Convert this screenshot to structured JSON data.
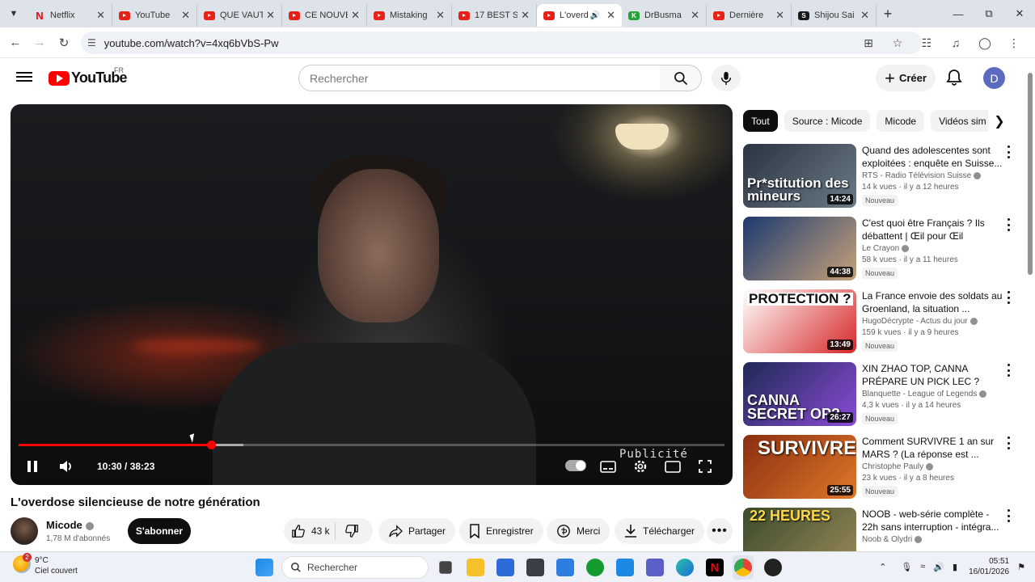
{
  "browser": {
    "tabs": [
      {
        "title": "Netflix",
        "icon": "netflix-icon"
      },
      {
        "title": "YouTube",
        "icon": "youtube-icon"
      },
      {
        "title": "QUE VAUT",
        "icon": "youtube-icon"
      },
      {
        "title": "CE NOUVE",
        "icon": "youtube-icon"
      },
      {
        "title": "Mistaking",
        "icon": "youtube-icon"
      },
      {
        "title": "17 BEST S",
        "icon": "youtube-icon"
      },
      {
        "title": "L'overd",
        "icon": "youtube-icon",
        "active": true,
        "audio": true
      },
      {
        "title": "DrBusma",
        "icon": "green-k-icon"
      },
      {
        "title": "Dernière",
        "icon": "youtube-icon"
      },
      {
        "title": "Shijou Sai",
        "icon": "shijou-icon"
      }
    ],
    "url": "youtube.com/watch?v=4xq6bVbS-Pw"
  },
  "youtube": {
    "logo_text": "YouTube",
    "country_code": "FR",
    "search_placeholder": "Rechercher",
    "create_label": "Créer",
    "avatar_letter": "D"
  },
  "player": {
    "time": "10:30 / 38:23",
    "ad_label": "Publicité",
    "progress_fraction": 0.273,
    "buffered_fraction": 0.318
  },
  "video": {
    "title": "L'overdose silencieuse de notre génération",
    "channel": "Micode",
    "subscribers": "1,78 M d'abonnés",
    "subscribe_label": "S'abonner",
    "likes": "43 k",
    "share_label": "Partager",
    "save_label": "Enregistrer",
    "thanks_label": "Merci",
    "download_label": "Télécharger"
  },
  "sidebar": {
    "chips": [
      "Tout",
      "Source : Micode",
      "Micode",
      "Vidéos sim"
    ],
    "recommendations": [
      {
        "title": "Quand des adolescentes sont exploitées : enquête en Suisse...",
        "channel": "RTS - Radio Télévision Suisse",
        "meta": "14 k vues · il y a 12 heures",
        "badge": "Nouveau",
        "duration": "14:24",
        "thumb_text": "Pr*stitution des mineurs",
        "colors": [
          "#2b3440",
          "#6b7a88"
        ]
      },
      {
        "title": "C'est quoi être Français ? Ils débattent | Œil pour Œil",
        "channel": "Le Crayon",
        "meta": "58 k vues · il y a 11 heures",
        "badge": "Nouveau",
        "duration": "44:38",
        "thumb_text": "",
        "colors": [
          "#1c3a6e",
          "#c7a27a"
        ]
      },
      {
        "title": "La France envoie des soldats au Groenland, la situation ...",
        "channel": "HugoDécrypte - Actus du jour",
        "meta": "159 k vues · il y a 9 heures",
        "badge": "Nouveau",
        "duration": "13:49",
        "thumb_text": "PROTECTION ?",
        "colors": [
          "#ffffff",
          "#d62828"
        ]
      },
      {
        "title": "XIN ZHAO TOP, CANNA PRÉPARE UN PICK LEC ?",
        "channel": "Blanquette - League of Legends",
        "meta": "4,3 k vues · il y a 14 heures",
        "badge": "Nouveau",
        "duration": "26:27",
        "thumb_text": "CANNA SECRET OP?",
        "colors": [
          "#1e2a55",
          "#8a4bd6"
        ]
      },
      {
        "title": "Comment SURVIVRE 1 an sur MARS ? (La réponse est ...",
        "channel": "Christophe Pauly",
        "meta": "23 k vues · il y a 8 heures",
        "badge": "Nouveau",
        "duration": "25:55",
        "thumb_text": "SURVIVRE",
        "colors": [
          "#8a2e10",
          "#e0782a"
        ]
      },
      {
        "title": "NOOB - web-série complète - 22h sans interruption - intégra...",
        "channel": "Noob & Olydri",
        "meta": "",
        "badge": "",
        "duration": "",
        "thumb_text": "22 HEURES",
        "colors": [
          "#3a4a2a",
          "#9b8a5a"
        ]
      }
    ]
  },
  "taskbar": {
    "temperature": "9°C",
    "weather": "Ciel couvert",
    "weather_badge": "2",
    "search_label": "Rechercher",
    "time": "05:51",
    "date": "16/01/2026"
  }
}
